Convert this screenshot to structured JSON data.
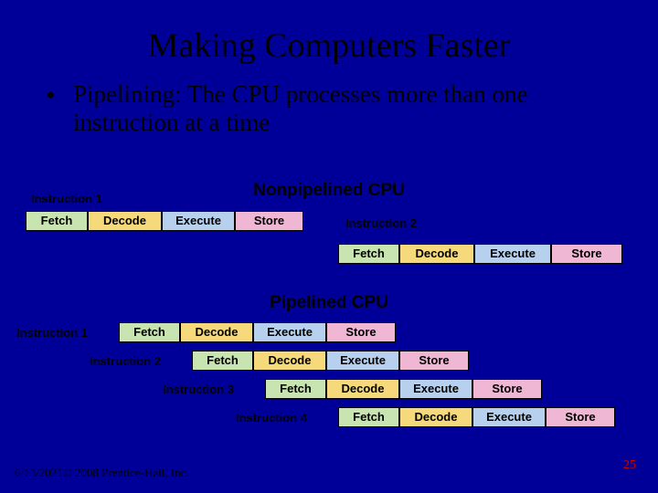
{
  "title": "Making Computers Faster",
  "bullet": "Pipelining: The CPU processes more than one instruction at a time",
  "headings": {
    "nonpipelined": "Nonpipelined CPU",
    "pipelined": "Pipelined CPU"
  },
  "stages": {
    "fetch": "Fetch",
    "decode": "Decode",
    "execute": "Execute",
    "store": "Store"
  },
  "labels": {
    "i1": "Instruction 1",
    "i2": "Instruction 2",
    "i3": "Instruction 3",
    "i4": "Instruction 4"
  },
  "footer": "6/13/2021© 2008  Prentice-Hall, Inc.",
  "slide_number": "25",
  "colors": {
    "background": "#000099",
    "fetch": "#c8e4b0",
    "decode": "#f6d97a",
    "execute": "#b7d0ee",
    "store": "#f0b7d4",
    "slidenum": "#cc0000"
  }
}
